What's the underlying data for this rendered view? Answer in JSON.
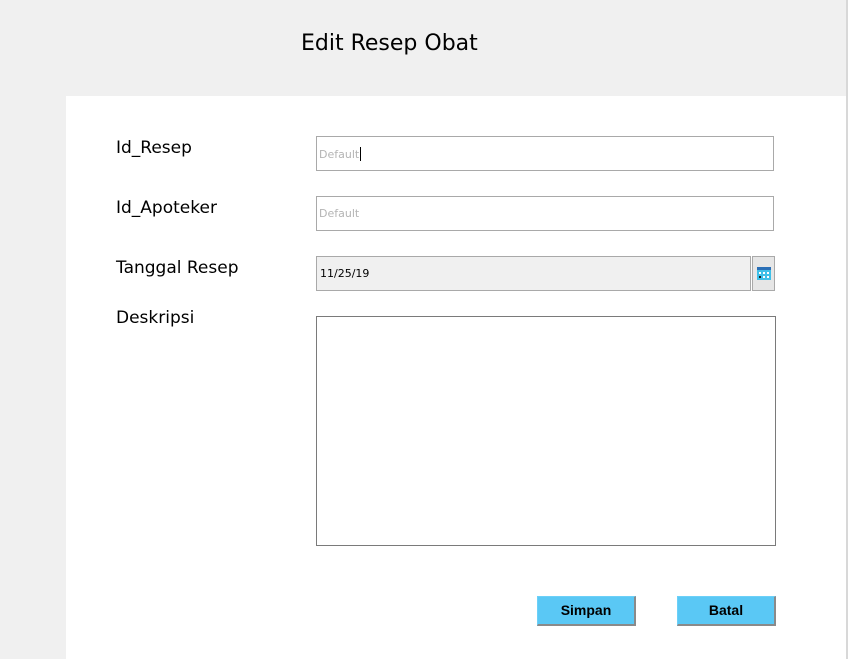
{
  "form": {
    "title": "Edit Resep Obat",
    "fields": {
      "id_resep": {
        "label": "Id_Resep",
        "placeholder": "Default"
      },
      "id_apoteker": {
        "label": "Id_Apoteker",
        "placeholder": "Default"
      },
      "tanggal_resep": {
        "label": "Tanggal Resep",
        "value": "11/25/19",
        "icon": "calendar-icon"
      },
      "deskripsi": {
        "label": "Deskripsi",
        "value": ""
      }
    },
    "buttons": {
      "simpan": "Simpan",
      "batal": "Batal"
    }
  },
  "colors": {
    "button_bg": "#5ac8f5",
    "background": "#f0f0f0",
    "panel": "#ffffff"
  }
}
